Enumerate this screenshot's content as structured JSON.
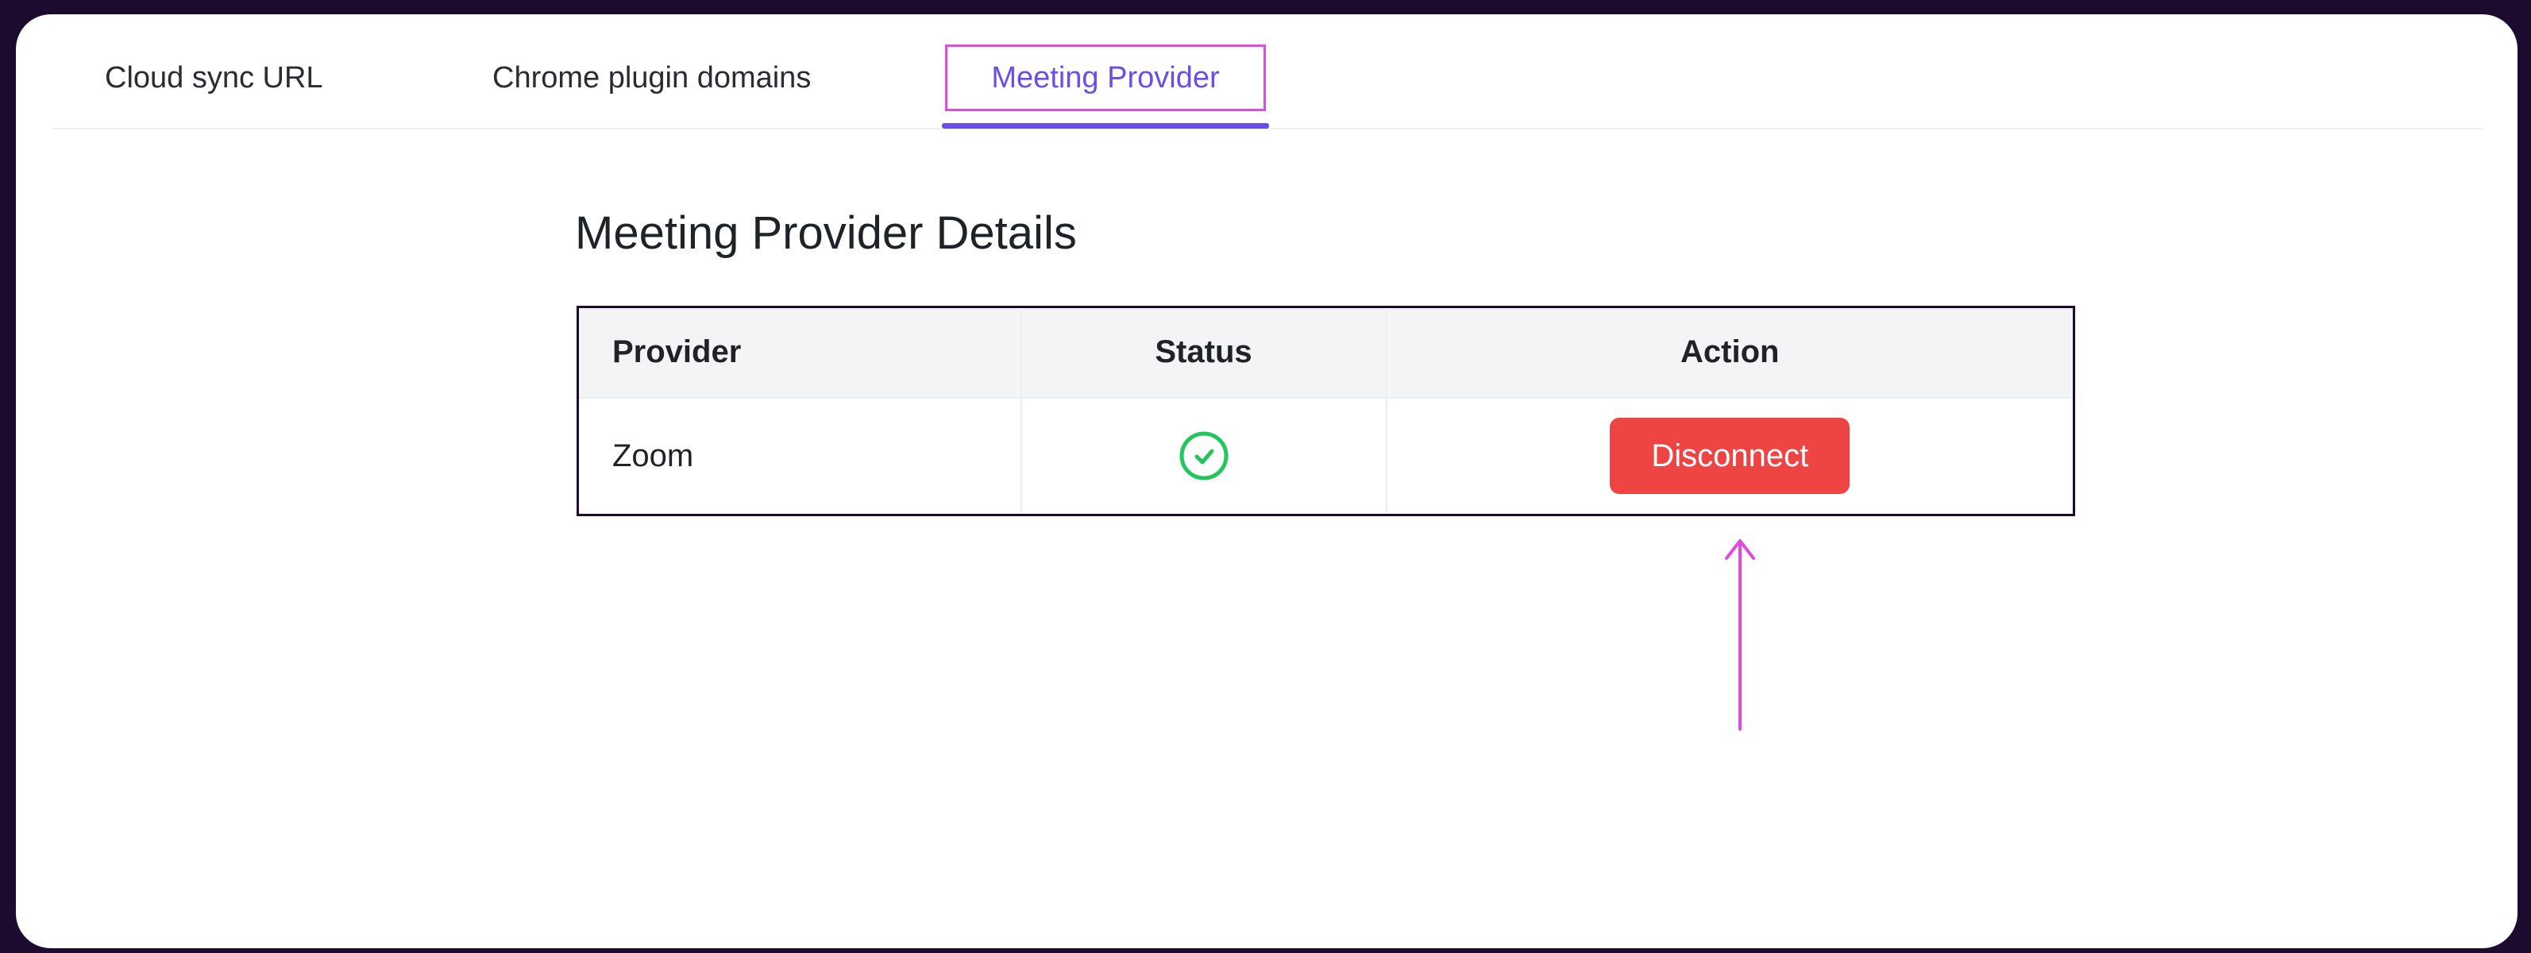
{
  "tabs": [
    {
      "label": "Cloud sync URL"
    },
    {
      "label": "Chrome plugin domains"
    },
    {
      "label": "Meeting Provider"
    }
  ],
  "section": {
    "title": "Meeting Provider Details"
  },
  "table": {
    "headers": {
      "provider": "Provider",
      "status": "Status",
      "action": "Action"
    },
    "rows": [
      {
        "provider": "Zoom",
        "status_icon": "check-circle-icon",
        "action_label": "Disconnect"
      }
    ]
  },
  "colors": {
    "accent": "#6a4ee6",
    "highlight": "#e04ae0",
    "danger": "#ef4444",
    "success": "#22c55e"
  }
}
